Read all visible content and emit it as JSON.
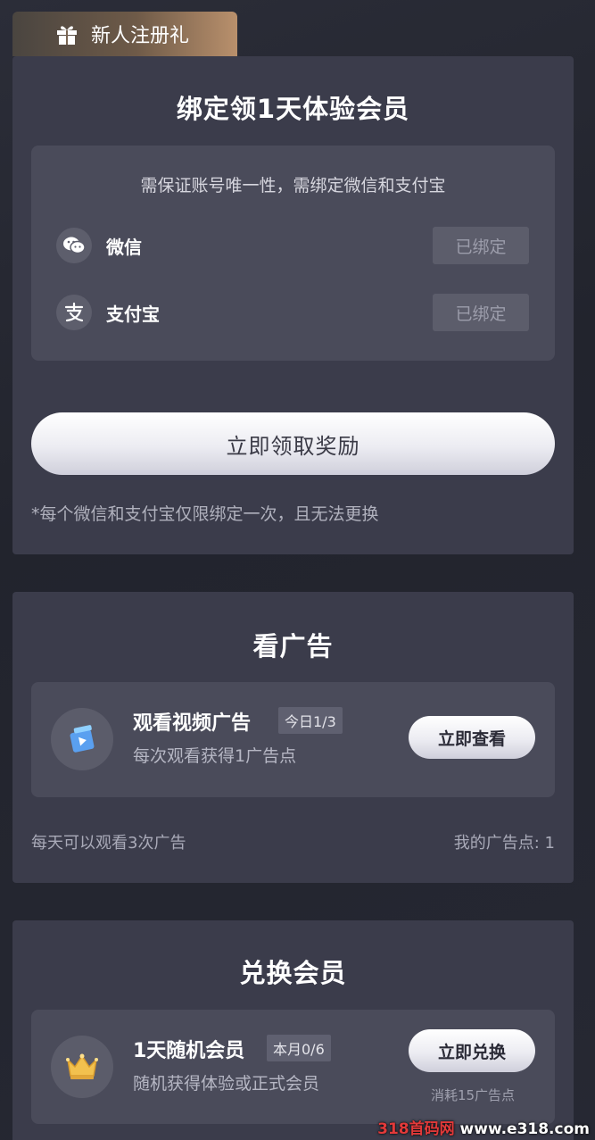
{
  "tab": {
    "label": "新人注册礼",
    "icon": "gift-icon"
  },
  "bind_card": {
    "title": "绑定领1天体验会员",
    "subtitle": "需保证账号唯一性，需绑定微信和支付宝",
    "rows": [
      {
        "name": "微信",
        "icon": "wechat-icon",
        "status": "已绑定"
      },
      {
        "name": "支付宝",
        "icon": "alipay-icon",
        "status": "已绑定"
      }
    ],
    "claim_label": "立即领取奖励",
    "note": "*每个微信和支付宝仅限绑定一次，且无法更换"
  },
  "ad_card": {
    "title": "看广告",
    "offer": {
      "title": "观看视频广告",
      "badge": "今日1/3",
      "desc": "每次观看获得1广告点",
      "button": "立即查看",
      "icon": "video-ad-icon"
    },
    "footer_left": "每天可以观看3次广告",
    "footer_right": "我的广告点: 1"
  },
  "redeem_card": {
    "title": "兑换会员",
    "offer": {
      "title": "1天随机会员",
      "badge": "本月0/6",
      "desc": "随机获得体验或正式会员",
      "button": "立即兑换",
      "cost": "消耗15广告点",
      "icon": "crown-icon"
    }
  },
  "watermark": {
    "red": "318首码网",
    "white": " www.e318.com"
  },
  "colors": {
    "card_bg": "#3b3c4b",
    "inner_bg": "#4a4b5a",
    "tab_accent": "#b9906c"
  }
}
